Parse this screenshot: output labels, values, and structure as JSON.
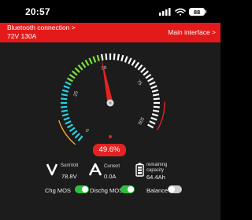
{
  "status_bar": {
    "time": "20:57",
    "battery_level": "88",
    "icons": [
      "signal-icon",
      "wifi-icon",
      "battery-icon"
    ]
  },
  "banner": {
    "bluetooth_label": "Bluetooth connection >",
    "voltage_current": "72V 130A",
    "main_interface_label": "Main interface >"
  },
  "gauge": {
    "title": "SOC",
    "ticks": [
      "0",
      "25",
      "50",
      "75",
      "100"
    ],
    "soc_percent": 49.6,
    "soc_text": "49.6%",
    "colors": {
      "accent": "#e52222",
      "arc_cyan": "#2ad0e0",
      "arc_green": "#7be040",
      "arc_white": "#ffffff"
    }
  },
  "stats": {
    "sum_volt": {
      "label": "SumVolt",
      "value": "78.8V",
      "icon": "volt-icon"
    },
    "current": {
      "label": "Current",
      "value": "0.0A",
      "icon": "ampere-icon"
    },
    "capacity": {
      "label_line1": "remaining",
      "label_line2": "capacity",
      "value": "64.4Ah",
      "icon": "battery-icon"
    }
  },
  "toggles": {
    "chg_mos": {
      "label": "Chg MOS",
      "on": true
    },
    "dischg_mos": {
      "label": "Dischg MOS",
      "on": true
    },
    "balance": {
      "label": "Balance",
      "on": false
    }
  }
}
